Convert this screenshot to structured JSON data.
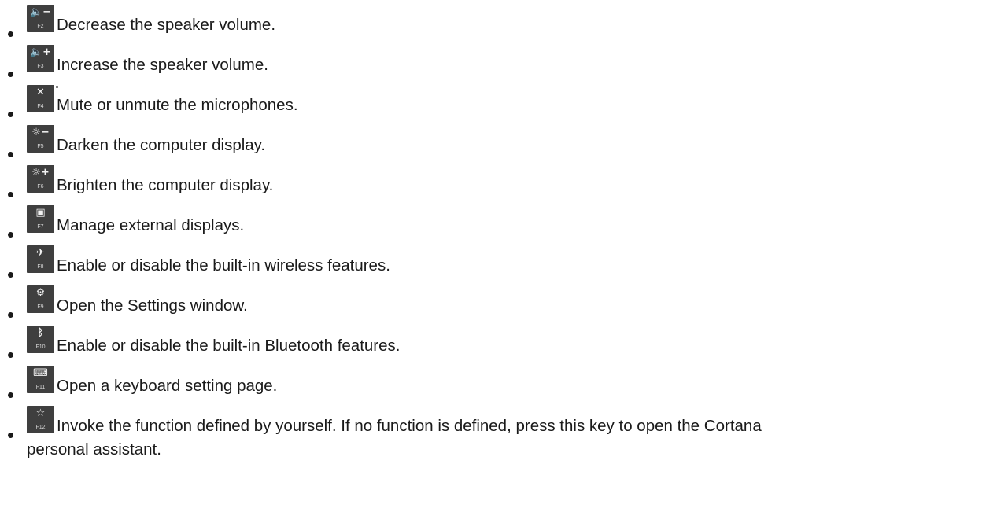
{
  "items": [
    {
      "key": "F2",
      "glyph": "🔈−",
      "text": "Decrease the speaker volume."
    },
    {
      "key": "F3",
      "glyph": "🔈+",
      "text": "Increase the speaker volume."
    },
    {
      "key": "F4",
      "glyph": "✕",
      "text": "Mute or unmute the microphones."
    },
    {
      "key": "F5",
      "glyph": "☼−",
      "text": "Darken the computer display."
    },
    {
      "key": "F6",
      "glyph": "☼+",
      "text": "Brighten the computer display."
    },
    {
      "key": "F7",
      "glyph": "▣",
      "text": "Manage external displays."
    },
    {
      "key": "F8",
      "glyph": "✈",
      "text": "Enable or disable the built-in wireless features."
    },
    {
      "key": "F9",
      "glyph": "⚙",
      "text": "Open the Settings window."
    },
    {
      "key": "F10",
      "glyph": "ᛒ",
      "text": "Enable or disable the built-in Bluetooth features."
    },
    {
      "key": "F11",
      "glyph": "⌨",
      "text": "Open a keyboard setting page."
    },
    {
      "key": "F12",
      "glyph": "☆",
      "text": "Invoke the function defined by yourself. If no function is defined, press this key to open the Cortana",
      "continuation": "personal assistant."
    }
  ]
}
